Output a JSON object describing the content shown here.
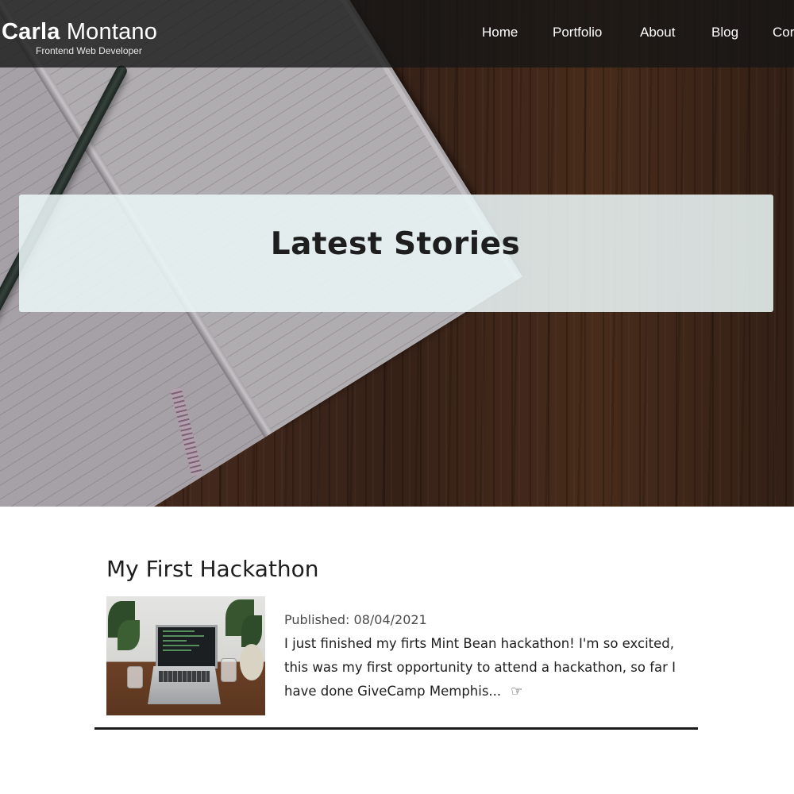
{
  "header": {
    "logo_first": "Carla",
    "logo_last": "Montano",
    "tagline": "Frontend Web Developer"
  },
  "nav": {
    "items": [
      "Home",
      "Portfolio",
      "About",
      "Blog",
      "Cor"
    ]
  },
  "hero": {
    "title": "Latest Stories"
  },
  "post": {
    "title": "My First Hackathon",
    "published": "Published: 08/04/2021",
    "excerpt": "I just finished my firts Mint Bean hackathon! I'm so excited, this was my first opportunity to attend a hackathon, so far I have done GiveCamp Memphis...",
    "read_more_icon": "hand-pointing-right-icon"
  },
  "colors": {
    "nav_bg": "#161616",
    "banner_bg": "#eaf6f6",
    "text": "#1d1d1d",
    "divider": "#1a1a1a"
  }
}
